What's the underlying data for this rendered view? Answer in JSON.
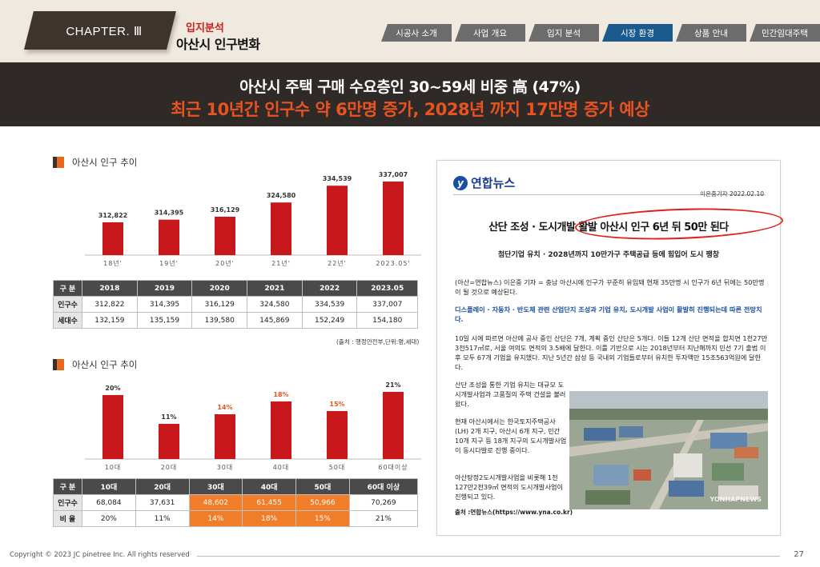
{
  "header": {
    "chapter": "CHAPTER. Ⅲ",
    "subtitle_red": "입지분석",
    "subtitle_black": "아산시 인구변화",
    "nav": [
      "시공사 소개",
      "사업 개요",
      "입지 분석",
      "시장 환경",
      "상품 안내",
      "민간임대주택"
    ],
    "active_nav": "시장 환경"
  },
  "banner": {
    "line1": "아산시 주택 구매 수요층인 30~59세 비중 高 (47%)",
    "line2": "최근 10년간 인구수 약 6만명 증가, 2028년 까지 17만명 증가 예상"
  },
  "section1": {
    "title": "아산시 인구 추이",
    "table_head": [
      "구 분",
      "2018",
      "2019",
      "2020",
      "2021",
      "2022",
      "2023.05"
    ],
    "rows": [
      {
        "label": "인구수",
        "values": [
          "312,822",
          "314,395",
          "316,129",
          "324,580",
          "334,539",
          "337,007"
        ]
      },
      {
        "label": "세대수",
        "values": [
          "132,159",
          "135,159",
          "139,580",
          "145,869",
          "152,249",
          "154,180"
        ]
      }
    ],
    "source": "(출처 : 행정안전부,단위:명,세대)"
  },
  "section2": {
    "title": "아산시 인구 추이",
    "table_head": [
      "구 분",
      "10대",
      "20대",
      "30대",
      "40대",
      "50대",
      "60대 이상"
    ],
    "rows": [
      {
        "label": "인구수",
        "values": [
          "68,084",
          "37,631",
          "48,602",
          "61,455",
          "50,966",
          "70,269"
        ]
      },
      {
        "label": "비 율",
        "values": [
          "20%",
          "11%",
          "14%",
          "18%",
          "15%",
          "21%"
        ]
      }
    ]
  },
  "chart_data": [
    {
      "type": "bar",
      "categories": [
        "18년'",
        "19년'",
        "20년'",
        "21년'",
        "22년'",
        "2023.05'"
      ],
      "values": [
        312822,
        314395,
        316129,
        324580,
        334539,
        337007
      ],
      "data_labels": [
        "312,822",
        "314,395",
        "316,129",
        "324,580",
        "334,539",
        "337,007"
      ],
      "title": "아산시 인구 추이",
      "color": "#c8181b"
    },
    {
      "type": "bar",
      "categories": [
        "10대",
        "20대",
        "30대",
        "40대",
        "50대",
        "60대이상"
      ],
      "values": [
        20,
        11,
        14,
        18,
        15,
        21
      ],
      "data_labels": [
        "20%",
        "11%",
        "14%",
        "18%",
        "15%",
        "21%"
      ],
      "highlighted": [
        "30대",
        "40대",
        "50대"
      ],
      "title": "아산시 인구 추이",
      "color": "#c8181b",
      "highlight_color": "#e8531f"
    }
  ],
  "news": {
    "logo": "연합뉴스",
    "logo_mark": "y",
    "reporter": "이은중기자 2022.02.10",
    "headline": "산단 조성 · 도시개발 활발 아산시 인구 6년 뒤 50만 된다",
    "subhead": "첨단기업 유치 · 2028년까지 10만가구 주택공급 등에 힘입어 도시 팽창",
    "para1": "(아산=연합뉴스) 이은중 기자 = 충남 아산시에 인구가 꾸준히 유입돼 현재 35만명 시 인구가 6년 뒤에는 50만명이 될 것으로 예상된다.",
    "para2": "디스플레이 · 자동차 · 반도체 관련 산업단지 조성과 기업 유치, 도시개발 사업이 활발히 진행되는데 따른 전망치다.",
    "para3": "10일 시에 따르면 아산에 공사 중인 산단은 7개, 계획 중인 산단은 5개다. 이들 12개 산단 면적을 합치면 1천27만3천517㎡로, 서울 여의도 면적의 3.5배에 달한다. 이를 기반으로 시는 2018년부터 지난해까지 민선 7기 출범 이후 모두 67개 기업을 유치했다. 지난 5년간 삼성 등 국내외 기업들로부터 유치한 투자액만 15조563억원에 달한다.",
    "para4": "산단 조성을 통한 기업 유치는 대규모 도시개발사업과 고품질의 주택 건설을 불러왔다.",
    "para5": "현재 아산시에서는 한국토지주택공사(LH) 2개 지구, 아산시 6개 지구, 민간 10개 지구 등 18개 지구의 도시개발사업이 동시다발로 진행 중이다.",
    "para6": "아산탕정2도시개발사업을 비롯해 1천127만2천39㎡ 면적의 도시개발사업이 진행되고 있다.",
    "source": "출처 :연합뉴스(https://www.yna.co.kr)",
    "photo_watermark": "YONHAPNEWS"
  },
  "footer": {
    "copyright": "Copyright © 2023 JC pinetree Inc. All rights reserved",
    "page": "27"
  }
}
